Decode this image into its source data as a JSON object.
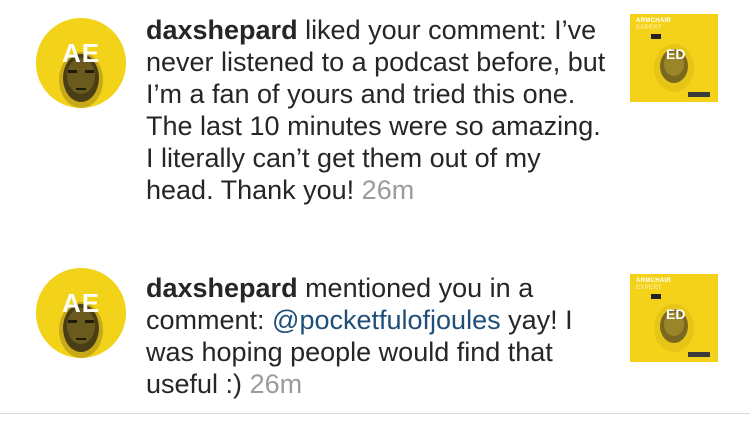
{
  "notifications": [
    {
      "avatar_text": "AE",
      "username": "daxshepard",
      "action": " liked your comment: I’ve never listened to a podcast before, but I’m a fan of yours and tried this one. The last 10 minutes were so amazing. I literally can’t get them out of my head. Thank you!",
      "time": "26m",
      "thumbnail": {
        "title": "ARMCHAIR",
        "subtitle": "EXPERT",
        "badge": "",
        "initials": "ED"
      }
    },
    {
      "avatar_text": "AE",
      "username": "daxshepard",
      "action_before": " mentioned you in a comment: ",
      "mention": "@pocketfulofjoules",
      "action_after": " yay! I was hoping people would find that useful :)",
      "time": "26m",
      "thumbnail": {
        "title": "ARMCHAIR",
        "subtitle": "EXPERT",
        "badge": "",
        "initials": "ED"
      }
    }
  ],
  "colors": {
    "brand_yellow": "#f2d31a",
    "text": "#262626",
    "mention": "#1f4e79",
    "time": "#9b9b9b",
    "divider": "#dbdbdb"
  }
}
